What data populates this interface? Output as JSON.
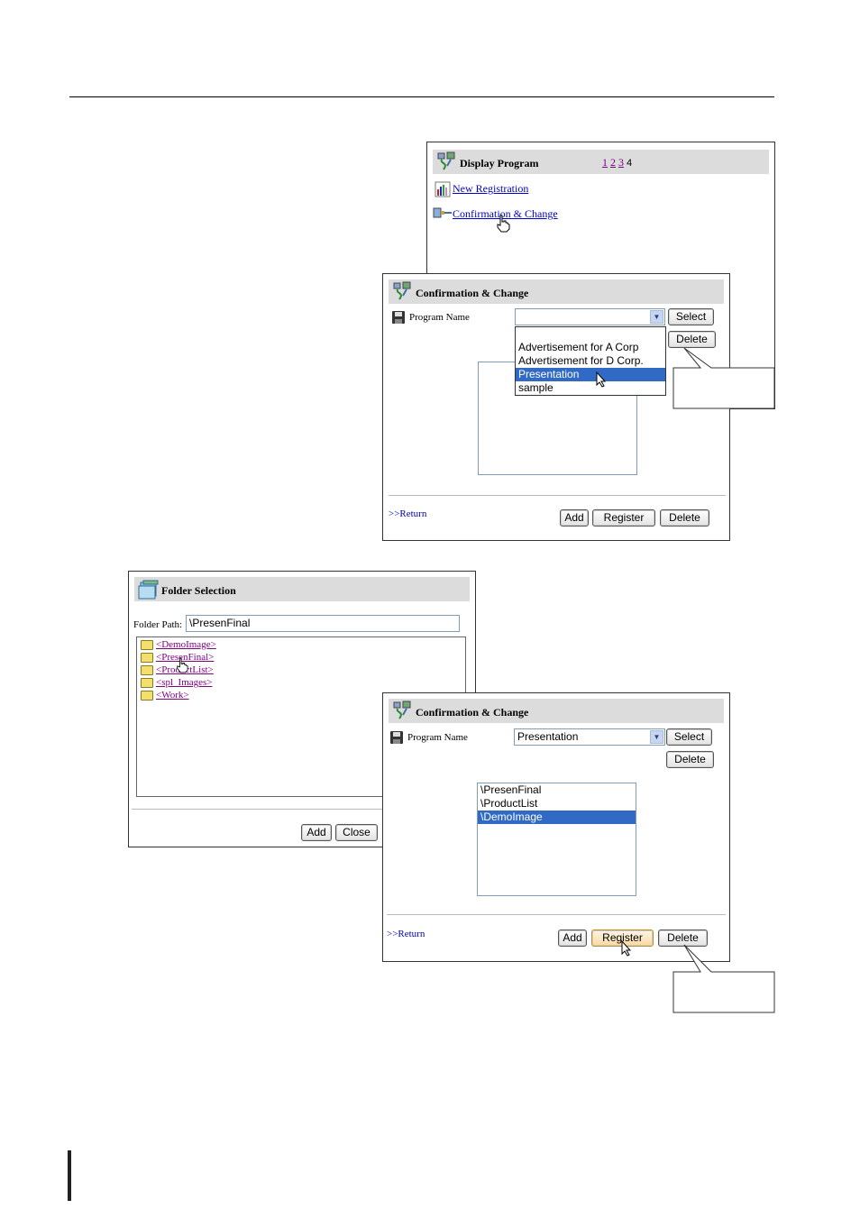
{
  "display_program": {
    "title": "Display Program",
    "pages": [
      "1",
      "2",
      "3"
    ],
    "current_page": "4",
    "new_registration": "New Registration",
    "confirmation_change": "Confirmation & Change"
  },
  "conf1": {
    "title": "Confirmation & Change",
    "program_name_label": "Program Name",
    "select_value": "",
    "select_button": "Select",
    "delete_button": "Delete",
    "dropdown_options": [
      "Advertisement for A Corp",
      "Advertisement for D Corp.",
      "Presentation",
      "sample"
    ],
    "highlighted_option": "Presentation",
    "return_link": ">>Return",
    "add_button": "Add",
    "register_button": "Register",
    "delete_bottom_button": "Delete"
  },
  "folder_selection": {
    "title": "Folder Selection",
    "folder_path_label": "Folder Path",
    "folder_path_value": "\\PresenFinal",
    "folders": [
      "<DemoImage>",
      "<PresenFinal>",
      "<ProductList>",
      "<spl_Images>",
      "<Work>"
    ],
    "add_button": "Add",
    "close_button": "Close"
  },
  "conf2": {
    "title": "Confirmation & Change",
    "program_name_label": "Program Name",
    "select_value": "Presentation",
    "select_button": "Select",
    "delete_button": "Delete",
    "list_items": [
      "\\PresenFinal",
      "\\ProductList",
      "\\DemoImage"
    ],
    "selected_item": "\\DemoImage",
    "return_link": ">>Return",
    "add_button": "Add",
    "register_button": "Register",
    "delete_bottom_button": "Delete"
  },
  "icons": {
    "title_icon": "network-icon",
    "new_registration_icon": "bar-chart-icon",
    "confirmation_icon": "connector-icon",
    "program_name_icon": "floppy-disk-icon",
    "folder_selection_icon": "folder-icon",
    "cursor": "pointer-cursor-icon"
  }
}
